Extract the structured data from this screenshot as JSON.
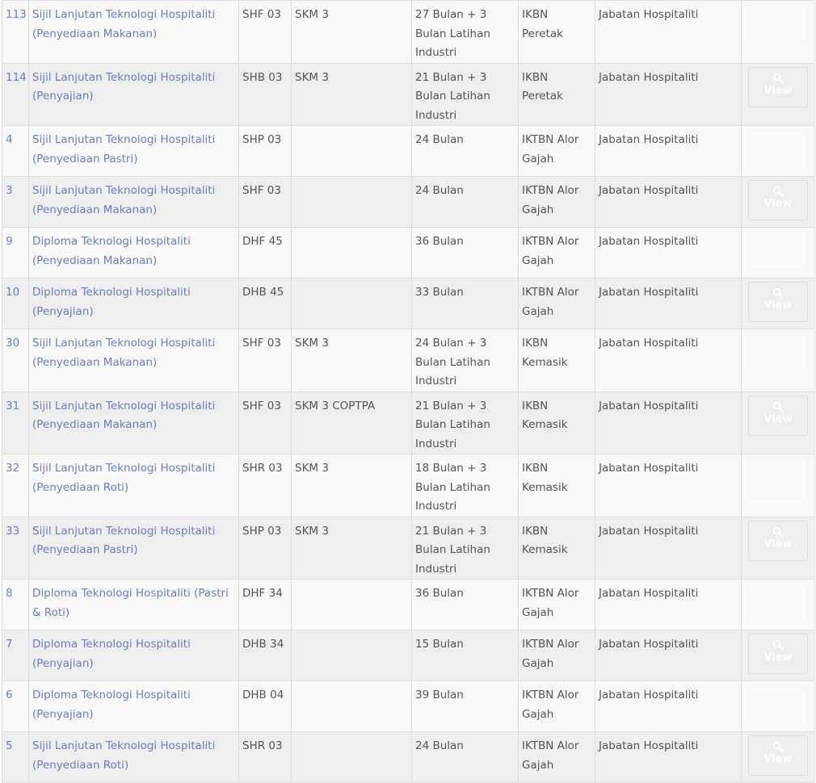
{
  "button_label": "View",
  "rows": [
    {
      "id": "113",
      "program": "Sijil Lanjutan Teknologi Hospitaliti (Penyediaan Makanan)",
      "code": "SHF 03",
      "level": "SKM 3",
      "duration": "27 Bulan + 3 Bulan Latihan Industri",
      "institute": "IKBN Peretak",
      "department": "Jabatan Hospitaliti"
    },
    {
      "id": "114",
      "program": "Sijil Lanjutan Teknologi Hospitaliti (Penyajian)",
      "code": "SHB 03",
      "level": "SKM 3",
      "duration": "21 Bulan + 3 Bulan Latihan Industri",
      "institute": "IKBN Peretak",
      "department": "Jabatan Hospitaliti"
    },
    {
      "id": "4",
      "program": "Sijil Lanjutan Teknologi Hospitaliti (Penyediaan Pastri)",
      "code": "SHP 03",
      "level": "",
      "duration": "24 Bulan",
      "institute": "IKTBN Alor Gajah",
      "department": "Jabatan Hospitaliti"
    },
    {
      "id": "3",
      "program": "Sijil Lanjutan Teknologi Hospitaliti (Penyediaan Makanan)",
      "code": "SHF 03",
      "level": "",
      "duration": "24 Bulan",
      "institute": "IKTBN Alor Gajah",
      "department": "Jabatan Hospitaliti"
    },
    {
      "id": "9",
      "program": "Diploma Teknologi Hospitaliti (Penyediaan Makanan)",
      "code": "DHF 45",
      "level": "",
      "duration": "36 Bulan",
      "institute": "IKTBN Alor Gajah",
      "department": "Jabatan Hospitaliti"
    },
    {
      "id": "10",
      "program": "Diploma Teknologi Hospitaliti (Penyajian)",
      "code": "DHB 45",
      "level": "",
      "duration": "33 Bulan",
      "institute": "IKTBN Alor Gajah",
      "department": "Jabatan Hospitaliti"
    },
    {
      "id": "30",
      "program": "Sijil Lanjutan Teknologi Hospitaliti (Penyediaan Makanan)",
      "code": "SHF 03",
      "level": "SKM 3",
      "duration": "24 Bulan + 3 Bulan Latihan Industri",
      "institute": "IKBN Kemasik",
      "department": "Jabatan Hospitaliti"
    },
    {
      "id": "31",
      "program": "Sijil Lanjutan Teknologi Hospitaliti (Penyediaan Makanan)",
      "code": "SHF 03",
      "level": "SKM 3 COPTPA",
      "duration": "21 Bulan + 3 Bulan Latihan Industri",
      "institute": "IKBN Kemasik",
      "department": "Jabatan Hospitaliti"
    },
    {
      "id": "32",
      "program": "Sijil Lanjutan Teknologi Hospitaliti (Penyediaan Roti)",
      "code": "SHR 03",
      "level": "SKM 3",
      "duration": "18 Bulan + 3 Bulan Latihan Industri",
      "institute": "IKBN Kemasik",
      "department": "Jabatan Hospitaliti"
    },
    {
      "id": "33",
      "program": "Sijil Lanjutan Teknologi Hospitaliti (Penyediaan Pastri)",
      "code": "SHP 03",
      "level": "SKM 3",
      "duration": "21 Bulan + 3 Bulan Latihan Industri",
      "institute": "IKBN Kemasik",
      "department": "Jabatan Hospitaliti"
    },
    {
      "id": "8",
      "program": "Diploma Teknologi Hospitaliti (Pastri & Roti)",
      "code": "DHF 34",
      "level": "",
      "duration": "36 Bulan",
      "institute": "IKTBN Alor Gajah",
      "department": "Jabatan Hospitaliti"
    },
    {
      "id": "7",
      "program": "Diploma Teknologi Hospitaliti (Penyajian)",
      "code": "DHB 34",
      "level": "",
      "duration": "15 Bulan",
      "institute": "IKTBN Alor Gajah",
      "department": "Jabatan Hospitaliti"
    },
    {
      "id": "6",
      "program": "Diploma Teknologi Hospitaliti (Penyajian)",
      "code": "DHB 04",
      "level": "",
      "duration": "39 Bulan",
      "institute": "IKTBN Alor Gajah",
      "department": "Jabatan Hospitaliti"
    },
    {
      "id": "5",
      "program": "Sijil Lanjutan Teknologi Hospitaliti (Penyediaan Roti)",
      "code": "SHR 03",
      "level": "",
      "duration": "24 Bulan",
      "institute": "IKTBN Alor Gajah",
      "department": "Jabatan Hospitaliti"
    }
  ]
}
